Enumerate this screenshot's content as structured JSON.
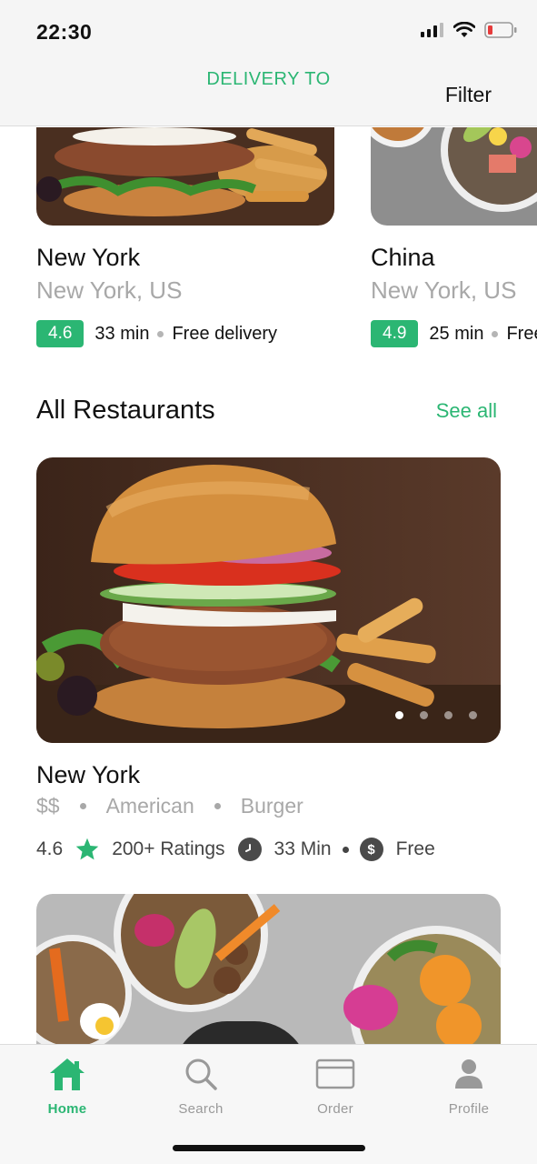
{
  "status_bar": {
    "time": "22:30"
  },
  "header": {
    "delivery_label": "DELIVERY TO",
    "filter_label": "Filter"
  },
  "featured": [
    {
      "name": "New York",
      "location": "New York, US",
      "rating": "4.6",
      "time": "33 min",
      "delivery": "Free delivery"
    },
    {
      "name": "China",
      "location": "New York, US",
      "rating": "4.9",
      "time": "25 min",
      "delivery": "Free delivery"
    }
  ],
  "all_restaurants": {
    "title": "All Restaurants",
    "see_all": "See all",
    "items": [
      {
        "name": "New York",
        "price": "$$",
        "cuisine": "American",
        "category": "Burger",
        "rating": "4.6",
        "ratings_count": "200+ Ratings",
        "time": "33 Min",
        "fee": "Free"
      }
    ]
  },
  "tabs": [
    {
      "label": "Home",
      "icon": "home-icon",
      "active": true
    },
    {
      "label": "Search",
      "icon": "search-icon",
      "active": false
    },
    {
      "label": "Order",
      "icon": "order-icon",
      "active": false
    },
    {
      "label": "Profile",
      "icon": "profile-icon",
      "active": false
    }
  ],
  "colors": {
    "accent": "#2bb673",
    "muted": "#a8a8a8",
    "text": "#111111"
  }
}
